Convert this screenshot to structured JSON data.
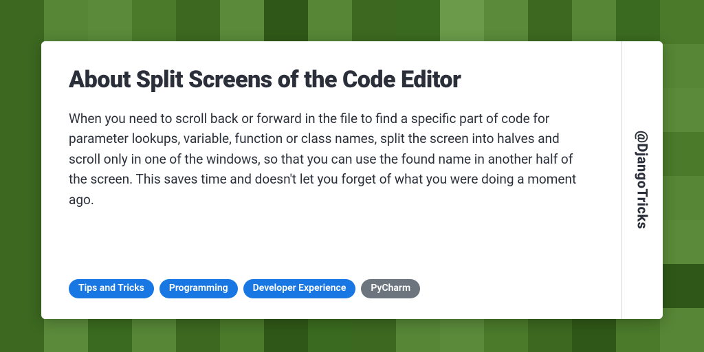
{
  "card": {
    "title": "About Split Screens of the Code Editor",
    "body": "When you need to scroll back or forward in the file to find a specific part of code for parameter lookups, variable, function or class names, split the screen into halves and scroll only in one of the windows, so that you can use the found name in another half of the screen. This saves time and doesn't let you forget of what you were doing a moment ago.",
    "handle": "@DjangoTricks"
  },
  "tags": [
    {
      "label": "Tips and Tricks",
      "variant": "primary"
    },
    {
      "label": "Programming",
      "variant": "primary"
    },
    {
      "label": "Developer Experience",
      "variant": "primary"
    },
    {
      "label": "PyCharm",
      "variant": "secondary"
    }
  ]
}
